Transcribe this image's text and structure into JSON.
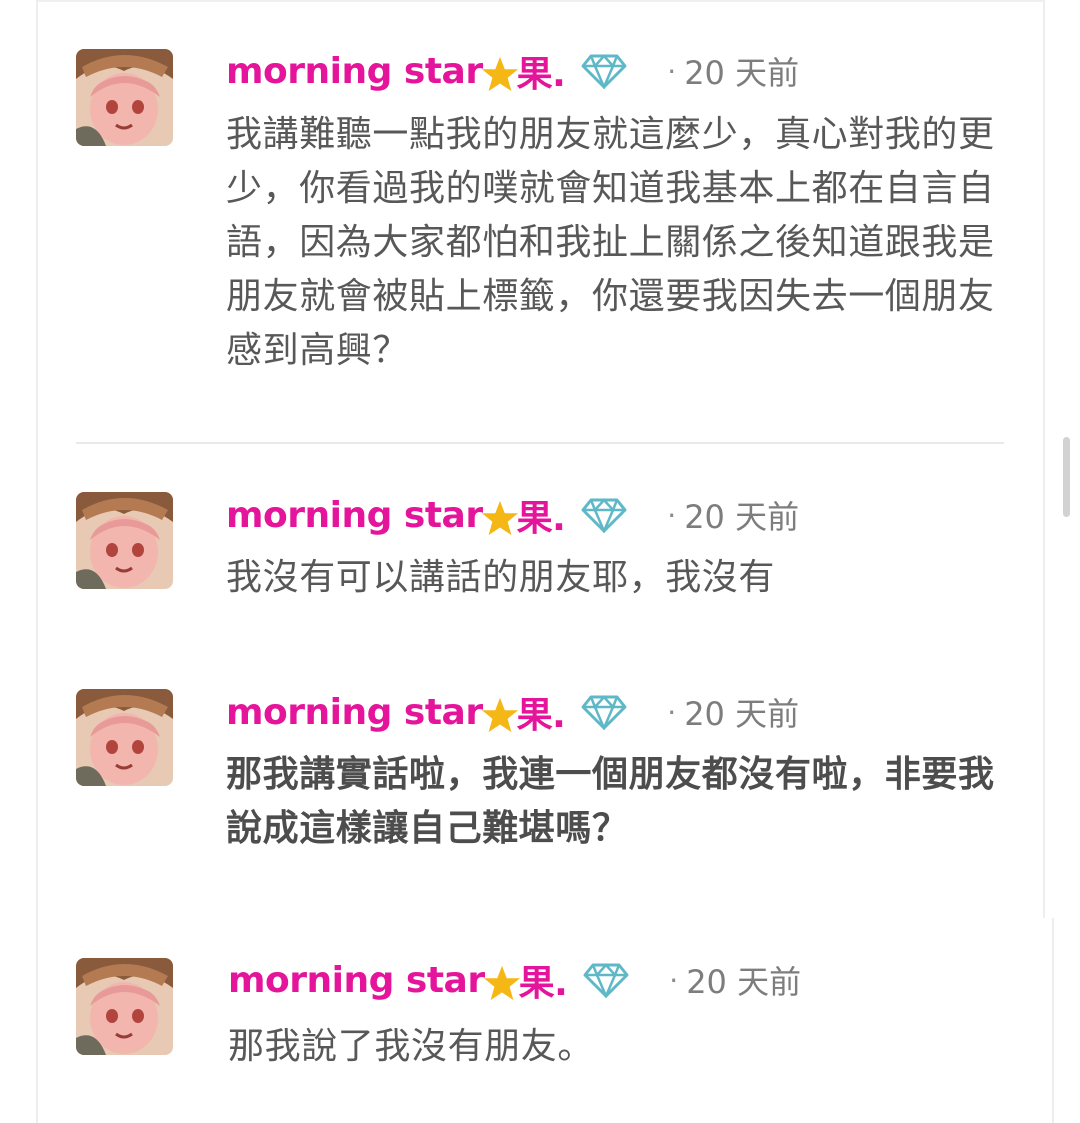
{
  "posts": [
    {
      "username": "morning star",
      "username_suffix": "果.",
      "separator": "·",
      "time": "20 天前",
      "text": "我講難聽一點我的朋友就這麼少，真心對我的更少，你看過我的噗就會知道我基本上都在自言自語，因為大家都怕和我扯上關係之後知道跟我是朋友就會被貼上標籤，你還要我因失去一個朋友感到高興？"
    },
    {
      "username": "morning star",
      "username_suffix": "果.",
      "separator": "·",
      "time": "20 天前",
      "text": "我沒有可以講話的朋友耶，我沒有"
    },
    {
      "username": "morning star",
      "username_suffix": "果.",
      "separator": "·",
      "time": "20 天前",
      "text": "那我講實話啦，我連一個朋友都沒有啦，非要我說成這樣讓自己難堪嗎？"
    },
    {
      "username": "morning star",
      "username_suffix": "果.",
      "separator": "·",
      "time": "20 天前",
      "text": "那我說了我沒有朋友。"
    }
  ],
  "icons": {
    "avatar": "anime-avatar",
    "star": "star-icon",
    "diamond": "diamond-icon"
  },
  "colors": {
    "username": "#e4159b",
    "star": "#f5b716",
    "diamond": "#5fb8c8",
    "body_text": "#585858",
    "time_text": "#7d7d7d"
  }
}
